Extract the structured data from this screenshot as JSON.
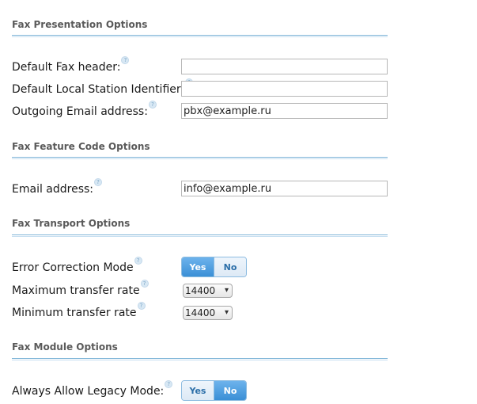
{
  "sections": [
    {
      "title": "Fax Presentation Options"
    },
    {
      "title": "Fax Feature Code Options"
    },
    {
      "title": "Fax Transport Options"
    },
    {
      "title": "Fax Module Options"
    }
  ],
  "presentation": {
    "header_label": "Default Fax header:",
    "header_value": "",
    "station_label": "Default Local Station Identifier:",
    "station_value": "",
    "email_label": "Outgoing Email address:",
    "email_value": "pbx@example.ru"
  },
  "feature_code": {
    "email_label": "Email address:",
    "email_value": "info@example.ru"
  },
  "transport": {
    "ecm_label": "Error Correction Mode",
    "ecm_yes": "Yes",
    "ecm_no": "No",
    "ecm_selected": "Yes",
    "max_label": "Maximum transfer rate",
    "max_value": "14400",
    "min_label": "Minimum transfer rate",
    "min_value": "14400"
  },
  "module": {
    "legacy_label": "Always Allow Legacy Mode:",
    "legacy_yes": "Yes",
    "legacy_no": "No",
    "legacy_selected": "No"
  },
  "icons": {
    "help": "help-icon",
    "dropdown": "chevron-down-icon"
  },
  "colors": {
    "accent": "#3a8fd6",
    "rule": "#7fb5d8"
  }
}
